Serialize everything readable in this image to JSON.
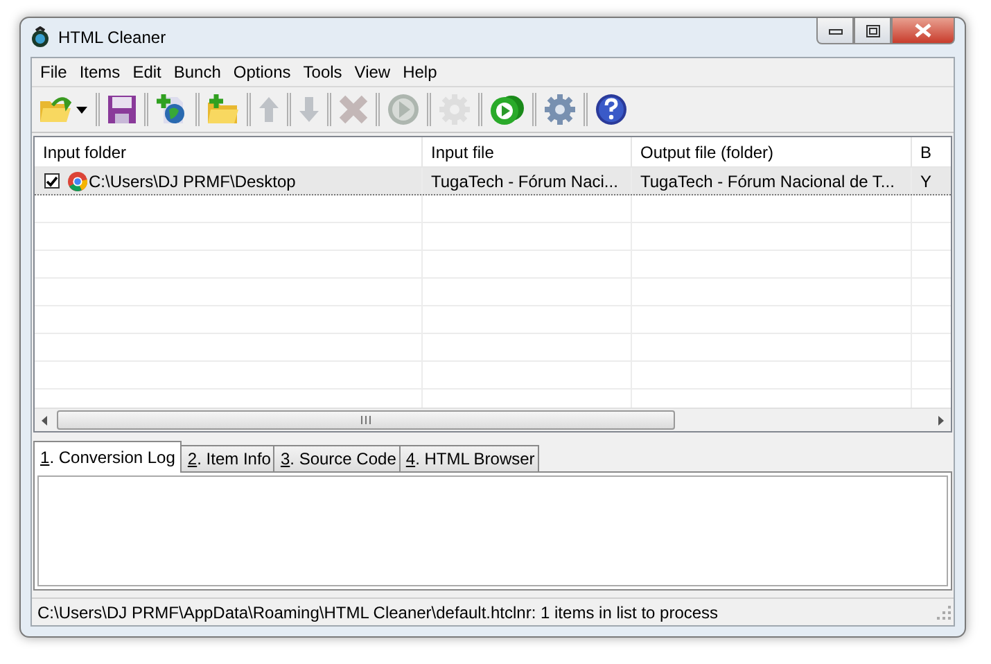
{
  "window": {
    "title": "HTML Cleaner"
  },
  "menu": [
    "File",
    "Items",
    "Edit",
    "Bunch",
    "Options",
    "Tools",
    "View",
    "Help"
  ],
  "toolbar": [
    {
      "kind": "open",
      "disabled": false
    },
    {
      "kind": "dropdown",
      "disabled": false
    },
    {
      "kind": "separator"
    },
    {
      "kind": "save",
      "disabled": false
    },
    {
      "kind": "separator"
    },
    {
      "kind": "add-web",
      "disabled": false
    },
    {
      "kind": "separator"
    },
    {
      "kind": "add-folder",
      "disabled": false
    },
    {
      "kind": "separator"
    },
    {
      "kind": "up",
      "disabled": true
    },
    {
      "kind": "separator"
    },
    {
      "kind": "down",
      "disabled": true
    },
    {
      "kind": "separator"
    },
    {
      "kind": "delete",
      "disabled": true
    },
    {
      "kind": "separator"
    },
    {
      "kind": "play",
      "disabled": true
    },
    {
      "kind": "separator"
    },
    {
      "kind": "gear",
      "disabled": true
    },
    {
      "kind": "separator"
    },
    {
      "kind": "play-all",
      "disabled": false
    },
    {
      "kind": "separator"
    },
    {
      "kind": "settings",
      "disabled": false
    },
    {
      "kind": "separator"
    },
    {
      "kind": "help",
      "disabled": false
    }
  ],
  "table": {
    "columns": [
      "Input folder",
      "Input file",
      "Output file (folder)",
      "B"
    ],
    "rows": [
      {
        "checked": true,
        "selected": true,
        "cells": [
          "C:\\Users\\DJ PRMF\\Desktop",
          "TugaTech - Fórum Naci...",
          "TugaTech - Fórum Nacional de T...",
          "Y"
        ]
      }
    ]
  },
  "tabs": [
    {
      "label": "1. Conversion Log",
      "selected": true
    },
    {
      "label": "2. Item Info",
      "selected": false
    },
    {
      "label": "3. Source Code",
      "selected": false
    },
    {
      "label": "4. HTML Browser",
      "selected": false
    }
  ],
  "status_bar": "C:\\Users\\DJ PRMF\\AppData\\Roaming\\HTML Cleaner\\default.htclnr: 1 items in list to process"
}
